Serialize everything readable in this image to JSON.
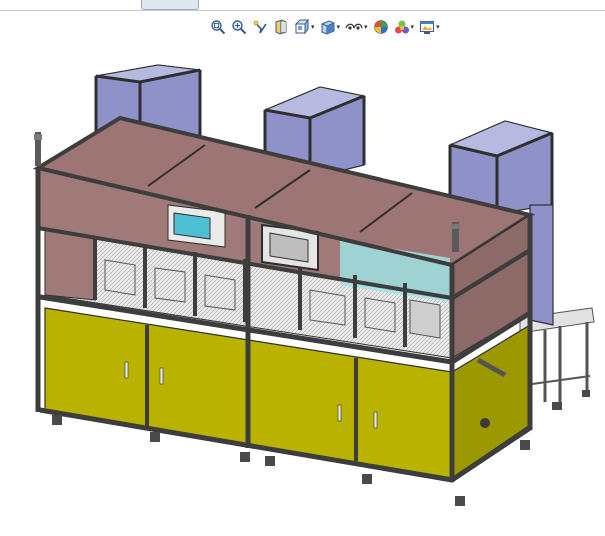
{
  "window": {
    "tab_label": ""
  },
  "toolbar": {
    "items": [
      {
        "name": "zoom-to-fit-icon",
        "dropdown": false
      },
      {
        "name": "zoom-to-area-icon",
        "dropdown": false
      },
      {
        "name": "previous-view-icon",
        "dropdown": false
      },
      {
        "name": "section-view-icon",
        "dropdown": false
      },
      {
        "name": "view-orientation-icon",
        "dropdown": true
      },
      {
        "name": "display-style-icon",
        "dropdown": true
      },
      {
        "name": "hide-show-items-icon",
        "dropdown": true
      },
      {
        "name": "edit-appearance-icon",
        "dropdown": false
      },
      {
        "name": "apply-scene-icon",
        "dropdown": true
      },
      {
        "name": "view-settings-icon",
        "dropdown": true
      }
    ],
    "dropdown_glyph": "▾"
  },
  "model": {
    "description_colors": {
      "frame": "#3d3d3d",
      "panel_brown": "#a07a78",
      "panel_olive": "#b9b300",
      "bin_blue": "#8e92c8",
      "glass_cyan": "#9fe3e3",
      "table_gray": "#d9d9d9"
    }
  }
}
